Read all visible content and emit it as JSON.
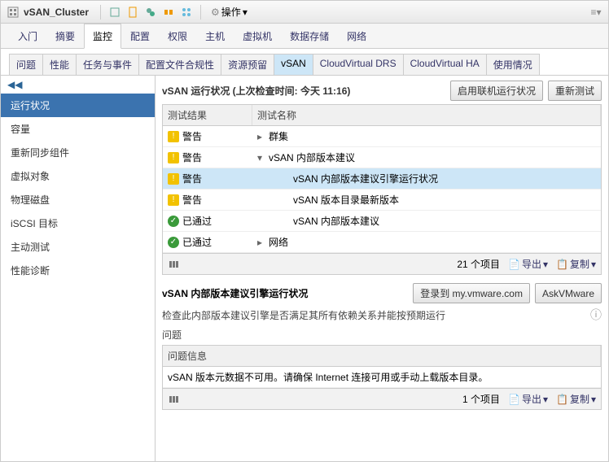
{
  "titlebar": {
    "title": "vSAN_Cluster",
    "ops_label": "操作"
  },
  "tabs1": [
    "入门",
    "摘要",
    "监控",
    "配置",
    "权限",
    "主机",
    "虚拟机",
    "数据存储",
    "网络"
  ],
  "tabs1_active": 2,
  "tabs2": [
    "问题",
    "性能",
    "任务与事件",
    "配置文件合规性",
    "资源预留",
    "vSAN",
    "CloudVirtual DRS",
    "CloudVirtual HA",
    "使用情况"
  ],
  "tabs2_active": 5,
  "sidebar": {
    "collapse": "◀◀",
    "items": [
      "运行状况",
      "容量",
      "重新同步组件",
      "虚拟对象",
      "物理磁盘",
      "iSCSI 目标",
      "主动测试",
      "性能诊断"
    ],
    "active": 0
  },
  "health": {
    "title_prefix": "vSAN 运行状况 (上次检查时间:",
    "title_time": "今天 11:16",
    "title_suffix": ")",
    "btn_enable": "启用联机运行状况",
    "btn_retest": "重新测试",
    "col_result": "测试结果",
    "col_name": "测试名称",
    "rows": [
      {
        "status": "warn",
        "label": "警告",
        "expand": "▸",
        "indent": 0,
        "name": "群集",
        "sel": false
      },
      {
        "status": "warn",
        "label": "警告",
        "expand": "▾",
        "indent": 0,
        "name": "vSAN 内部版本建议",
        "sel": false
      },
      {
        "status": "warn",
        "label": "警告",
        "expand": "",
        "indent": 2,
        "name": "vSAN 内部版本建议引擎运行状况",
        "sel": true
      },
      {
        "status": "warn",
        "label": "警告",
        "expand": "",
        "indent": 2,
        "name": "vSAN 版本目录最新版本",
        "sel": false
      },
      {
        "status": "ok",
        "label": "已通过",
        "expand": "",
        "indent": 2,
        "name": "vSAN 内部版本建议",
        "sel": false
      },
      {
        "status": "ok",
        "label": "已通过",
        "expand": "▸",
        "indent": 0,
        "name": "网络",
        "sel": false
      }
    ],
    "footer_count": "21 个项目",
    "export": "导出",
    "copy": "复制"
  },
  "detail": {
    "title": "vSAN 内部版本建议引擎运行状况",
    "btn_login": "登录到 my.vmware.com",
    "btn_ask": "AskVMware",
    "desc": "检查此内部版本建议引擎是否满足其所有依赖关系并能按预期运行",
    "issues_label": "问题",
    "col_msg": "问题信息",
    "msg": "vSAN 版本元数据不可用。请确保 Internet 连接可用或手动上载版本目录。",
    "footer_count": "1 个项目",
    "export": "导出",
    "copy": "复制"
  }
}
